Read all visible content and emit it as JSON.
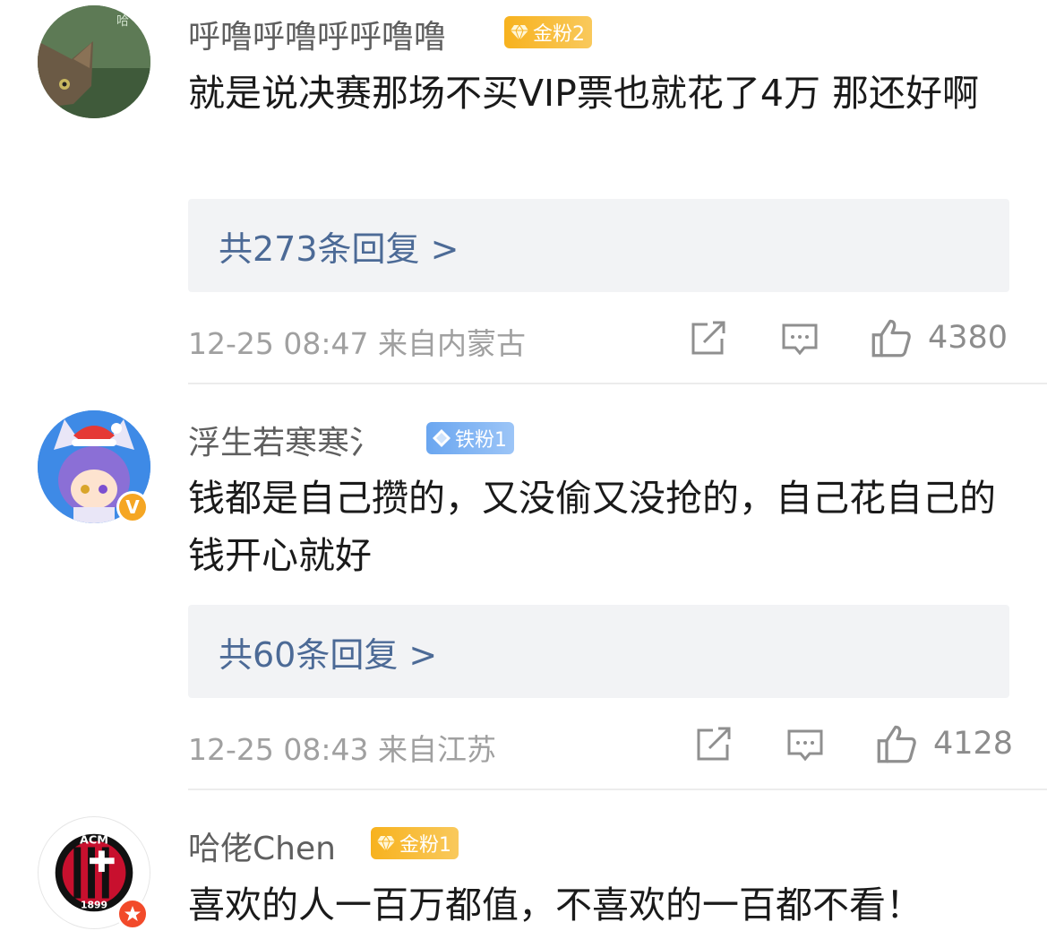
{
  "comments": [
    {
      "username": "呼噜呼噜呼呼噜噜",
      "badge": "金粉2",
      "text": "就是说决赛那场不买VIP票也就花了4万 那还好啊",
      "replies": "共273条回复 >",
      "time": "12-25 08:47",
      "location": "来自内蒙古",
      "likes": "4380"
    },
    {
      "username": "浮生若寒寒氵",
      "badge": "铁粉1",
      "text": "钱都是自己攒的，又没偷又没抢的，自己花自己的钱开心就好",
      "replies": "共60条回复 >",
      "time": "12-25 08:43",
      "location": "来自江苏",
      "likes": "4128",
      "verified_label": "V"
    },
    {
      "username": "哈佬Chen",
      "badge": "金粉1",
      "text": "喜欢的人一百万都值，不喜欢的一百都不看！",
      "logo_text": "ACM",
      "logo_year": "1899"
    }
  ],
  "colors": {
    "reply_link": "#4c6a96",
    "gold_badge": "#f7b21e",
    "iron_badge": "#6aa6f0",
    "verified_orange": "#f5a623",
    "verified_red": "#f24a2a"
  },
  "icons": [
    "share-icon",
    "comment-icon",
    "like-icon",
    "gem-icon",
    "verified-icon"
  ]
}
